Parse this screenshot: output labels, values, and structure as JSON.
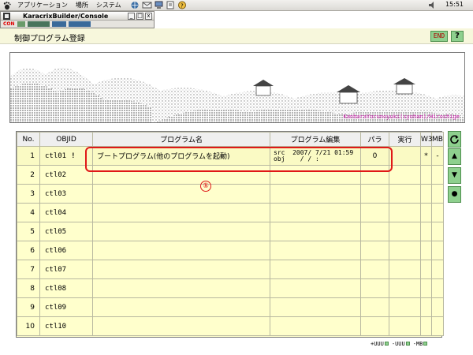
{
  "panel": {
    "menus": [
      "アプリケーション",
      "場所",
      "システム"
    ],
    "tray_icons": [
      "browser-icon",
      "mail-icon",
      "network-icon",
      "edit-icon",
      "help-icon"
    ],
    "clock": "15:51"
  },
  "console": {
    "title": "KaracrixBuilder/Console",
    "toolbar_label": "CON",
    "buttons": [
      "_",
      "□",
      "x"
    ]
  },
  "header": {
    "title": "制御プログラム登録",
    "end_label": "END",
    "help_label": "?"
  },
  "banner": {
    "caption": "KanbaraYorunoyuki(syohan)/Hiroshige"
  },
  "table": {
    "columns": [
      "No.",
      "OBJID",
      "プログラム名",
      "プログラム編集",
      "パラ",
      "実行",
      "W3",
      "MB"
    ],
    "rows": [
      {
        "no": "1",
        "objid": "ctl01",
        "flag": "!",
        "name": "ブートプログラム(他のプログラムを起動)",
        "edit_src": "src",
        "edit_obj": "obj",
        "edit_date1": "2007/ 7/21 01:59",
        "edit_date2": "/  /        :",
        "para": "0",
        "exec": "",
        "w3": "*",
        "mb": "-"
      },
      {
        "no": "2",
        "objid": "ctl02",
        "flag": "",
        "name": "",
        "edit_src": "",
        "edit_obj": "",
        "edit_date1": "",
        "edit_date2": "",
        "para": "",
        "exec": "",
        "w3": "",
        "mb": ""
      },
      {
        "no": "3",
        "objid": "ctl03",
        "flag": "",
        "name": "",
        "edit_src": "",
        "edit_obj": "",
        "edit_date1": "",
        "edit_date2": "",
        "para": "",
        "exec": "",
        "w3": "",
        "mb": ""
      },
      {
        "no": "4",
        "objid": "ctl04",
        "flag": "",
        "name": "",
        "edit_src": "",
        "edit_obj": "",
        "edit_date1": "",
        "edit_date2": "",
        "para": "",
        "exec": "",
        "w3": "",
        "mb": ""
      },
      {
        "no": "5",
        "objid": "ctl05",
        "flag": "",
        "name": "",
        "edit_src": "",
        "edit_obj": "",
        "edit_date1": "",
        "edit_date2": "",
        "para": "",
        "exec": "",
        "w3": "",
        "mb": ""
      },
      {
        "no": "6",
        "objid": "ctl06",
        "flag": "",
        "name": "",
        "edit_src": "",
        "edit_obj": "",
        "edit_date1": "",
        "edit_date2": "",
        "para": "",
        "exec": "",
        "w3": "",
        "mb": ""
      },
      {
        "no": "7",
        "objid": "ctl07",
        "flag": "",
        "name": "",
        "edit_src": "",
        "edit_obj": "",
        "edit_date1": "",
        "edit_date2": "",
        "para": "",
        "exec": "",
        "w3": "",
        "mb": ""
      },
      {
        "no": "8",
        "objid": "ctl08",
        "flag": "",
        "name": "",
        "edit_src": "",
        "edit_obj": "",
        "edit_date1": "",
        "edit_date2": "",
        "para": "",
        "exec": "",
        "w3": "",
        "mb": ""
      },
      {
        "no": "9",
        "objid": "ctl09",
        "flag": "",
        "name": "",
        "edit_src": "",
        "edit_obj": "",
        "edit_date1": "",
        "edit_date2": "",
        "para": "",
        "exec": "",
        "w3": "",
        "mb": ""
      },
      {
        "no": "10",
        "objid": "ctl10",
        "flag": "",
        "name": "",
        "edit_src": "",
        "edit_obj": "",
        "edit_date1": "",
        "edit_date2": "",
        "para": "",
        "exec": "",
        "w3": "",
        "mb": ""
      }
    ]
  },
  "nav": {
    "refresh_icon": "refresh-icon",
    "up_label": "▲",
    "down_label": "▼",
    "dot_label": "●"
  },
  "annotation": {
    "number": "①"
  },
  "footer": {
    "items": [
      "+UUU",
      "-UUU",
      "-MB"
    ]
  }
}
